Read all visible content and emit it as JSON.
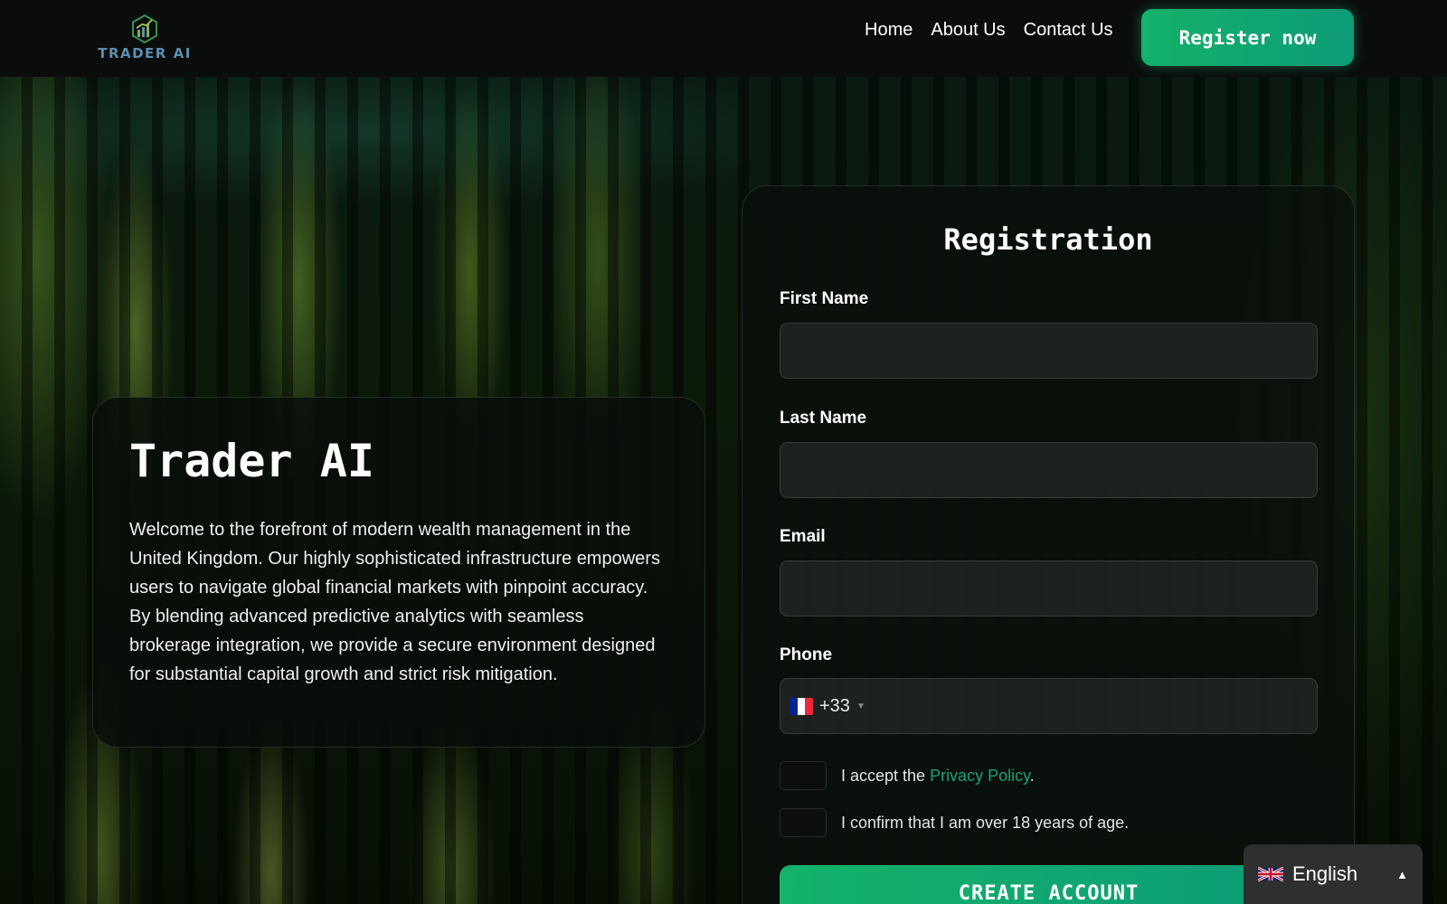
{
  "header": {
    "logo_text": "TRADER AI",
    "nav": [
      {
        "label": "Home"
      },
      {
        "label": "About Us"
      },
      {
        "label": "Contact Us"
      }
    ],
    "register_label": "Register now"
  },
  "hero": {
    "title": "Trader AI",
    "text": "Welcome to the forefront of modern wealth management in the United Kingdom. Our highly sophisticated infrastructure empowers users to navigate global financial markets with pinpoint accuracy. By blending advanced predictive analytics with seamless brokerage integration, we provide a secure environment designed for substantial capital growth and strict risk mitigation."
  },
  "registration": {
    "title": "Registration",
    "first_name_label": "First Name",
    "first_name_value": "",
    "last_name_label": "Last Name",
    "last_name_value": "",
    "email_label": "Email",
    "email_value": "",
    "phone_label": "Phone",
    "phone_country_flag": "flag-fr-icon",
    "phone_dial_code": "+33",
    "phone_value": "",
    "privacy_prefix": "I accept the ",
    "privacy_link": "Privacy Policy",
    "privacy_suffix": ".",
    "age_confirm": "I confirm that I am over 18 years of age.",
    "create_label": "CREATE ACCOUNT"
  },
  "language": {
    "flag": "flag-uk-icon",
    "label": "English",
    "caret": "▲"
  },
  "colors": {
    "accent": "#14b26a",
    "link": "#19a07a",
    "logo_text": "#5c8fb0"
  }
}
